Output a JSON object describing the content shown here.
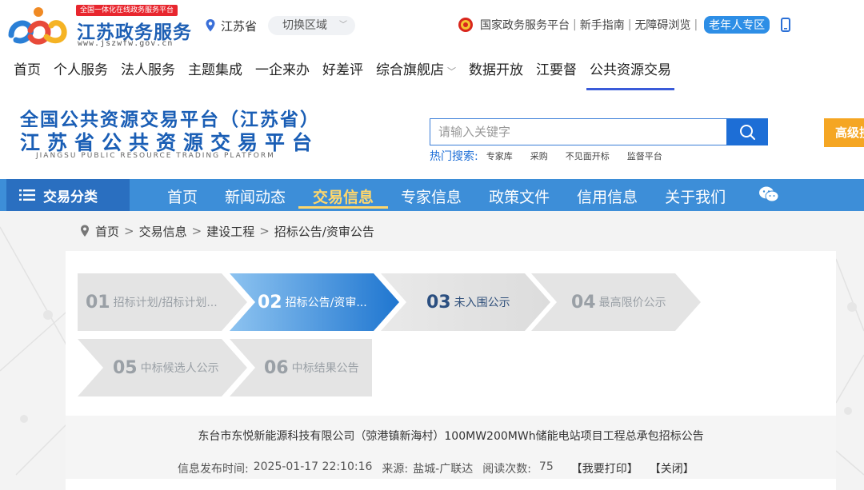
{
  "header": {
    "slogan": "全国一体化在线政务服务平台",
    "logo_title": "江苏政务服务",
    "logo_url": "www.jszwfw.gov.cn",
    "region": "江苏省",
    "switch_region": "切换区域",
    "links": {
      "national_platform": "国家政务服务平台",
      "guide": "新手指南",
      "accessible": "无障碍浏览",
      "elder": "老年人专区"
    }
  },
  "main_nav": {
    "items": [
      "首页",
      "个人服务",
      "法人服务",
      "主题集成",
      "一企来办",
      "好差评",
      "综合旗舰店",
      "数据开放",
      "江要督",
      "公共资源交易"
    ]
  },
  "banner": {
    "title_line1": "全国公共资源交易平台（江苏省）",
    "title_line2": "江苏省公共资源交易平台",
    "title_en": "JIANGSU PUBLIC RESOURCE TRADING PLATFORM"
  },
  "search": {
    "placeholder": "请输入关键字",
    "advanced_label": "高级搜",
    "hot_label": "热门搜索:",
    "hot_tags": [
      "专家库",
      "采购",
      "不见面开标",
      "监督平台"
    ]
  },
  "channel_nav": {
    "category_label": "交易分类",
    "items": [
      "首页",
      "新闻动态",
      "交易信息",
      "专家信息",
      "政策文件",
      "信用信息",
      "关于我们"
    ]
  },
  "breadcrumb": [
    "首页",
    "交易信息",
    "建设工程",
    "招标公告/资审公告"
  ],
  "steps": [
    {
      "num": "01",
      "label": "招标计划/招标计划..."
    },
    {
      "num": "02",
      "label": "招标公告/资审..."
    },
    {
      "num": "03",
      "label": "未入围公示"
    },
    {
      "num": "04",
      "label": "最高限价公示"
    },
    {
      "num": "05",
      "label": "中标候选人公示"
    },
    {
      "num": "06",
      "label": "中标结果公告"
    }
  ],
  "article": {
    "title": "东台市东悦新能源科技有限公司（弶港镇新海村）100MW200MWh储能电站项目工程总承包招标公告",
    "publish_label": "信息发布时间:",
    "publish_time": "2025-01-17 22:10:16",
    "source_label": "来源:",
    "source": "盐城-广联达",
    "views_label": "阅读次数:",
    "views": "75",
    "print_label": "【我要打印】",
    "close_label": "【关闭】"
  },
  "colors": {
    "brand_blue": "#1d5fb4",
    "channel_nav": "#3d8ed8",
    "active_yellow": "#ffd76b",
    "step_active": "#2f82d6",
    "advanced_orange": "#f5a623"
  }
}
